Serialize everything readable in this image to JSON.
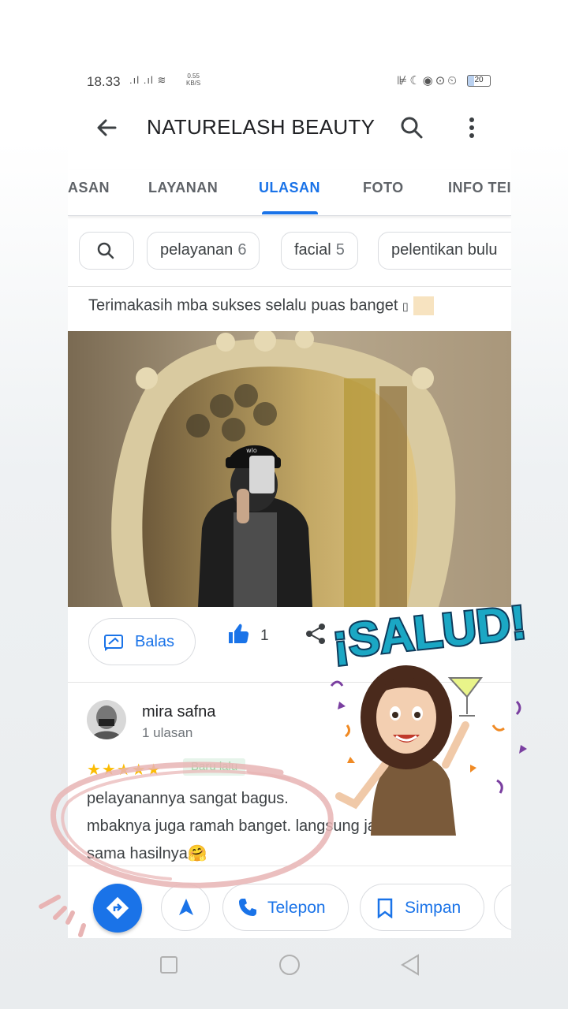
{
  "status_bar": {
    "time": "18.33",
    "net_speed_value": "0.55",
    "net_speed_unit": "KB/S",
    "battery": "20"
  },
  "app_bar": {
    "title": "NATURELASH BEAUTY"
  },
  "tabs": [
    {
      "label": "ULASAN"
    },
    {
      "label": "LAYANAN"
    },
    {
      "label": "ULASAN"
    },
    {
      "label": "FOTO"
    },
    {
      "label": "INFO TEN"
    }
  ],
  "tabs_visible": {
    "partial_left": "ASAN",
    "layanan": "LAYANAN",
    "ulasan": "ULASAN",
    "foto": "FOTO",
    "info": "INFO TEI"
  },
  "chips": [
    {
      "label": "pelayanan",
      "count": "6"
    },
    {
      "label": "facial",
      "count": "5"
    },
    {
      "label": "pelentikan bulu"
    }
  ],
  "previous_review_text": "Terimakasih mba sukses selalu puas banget",
  "photo_cap_text": "wlo",
  "actions": {
    "reply_label": "Balas",
    "like_count": "1"
  },
  "reviewer": {
    "name": "mira safna",
    "meta": "1 ulasan",
    "badge": "Baru lalu",
    "stars": "★★★★★",
    "body_line1": "pelayanannya sangat bagus.",
    "body_line2": "mbaknya juga ramah banget. langsung jatuh cinta",
    "body_line3": "sama hasilnya🤗"
  },
  "bottom_bar": {
    "call_label": "Telepon",
    "save_label": "Simpan"
  },
  "sticker_text": "¡SALUD!",
  "colors": {
    "accent": "#1a73e8",
    "star": "#fbbc04",
    "annotation": "#e8b4b4"
  }
}
